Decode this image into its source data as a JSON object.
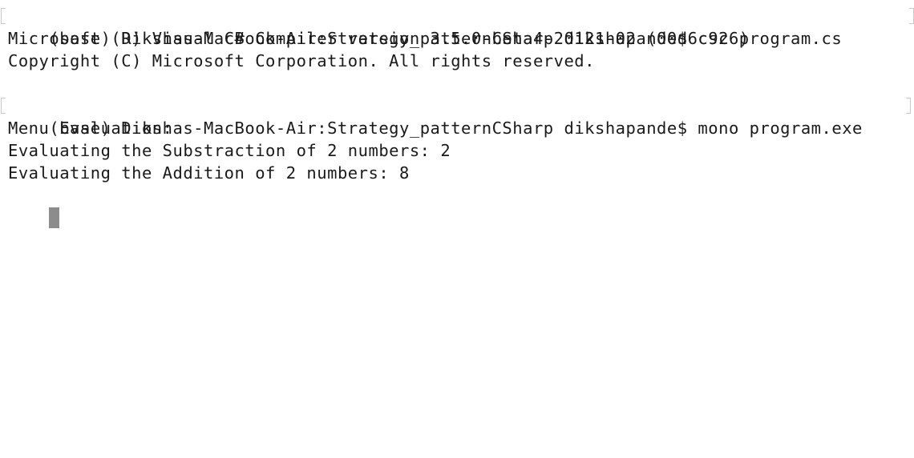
{
  "colors": {
    "background": "#ffffff",
    "text": "#1a1a1a",
    "cursor": "#8c8c8c",
    "mark": "#c9c9c9"
  },
  "terminal": {
    "lines": [
      "(base) Dikshas-MacBook-Air:Strategy_patternCSharp dikshapande$ csc program.cs",
      "Microsoft (R) Visual C# Compiler version 3.5.0-beta4-20121-02 (00d6c926)",
      "Copyright (C) Microsoft Corporation. All rights reserved.",
      "",
      "(base) Dikshas-MacBook-Air:Strategy_patternCSharp dikshapande$ mono program.exe",
      "Menu Evaluation:",
      "Evaluating the Substraction of 2 numbers: 2",
      "Evaluating the Addition of 2 numbers: 8"
    ]
  }
}
